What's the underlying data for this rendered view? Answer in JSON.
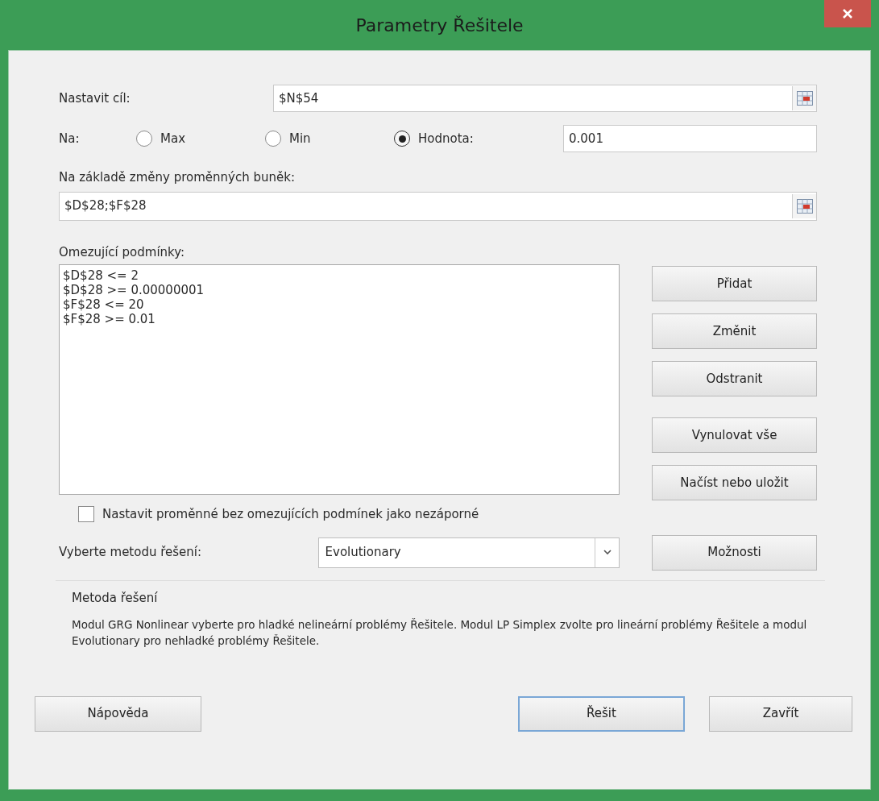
{
  "window": {
    "title": "Parametry Řešitele"
  },
  "objective": {
    "label": "Nastavit cíl:",
    "value": "$N$54"
  },
  "target": {
    "label": "Na:",
    "options": [
      {
        "label": "Max",
        "selected": false
      },
      {
        "label": "Min",
        "selected": false
      },
      {
        "label": "Hodnota:",
        "selected": true
      }
    ],
    "value": "0.001"
  },
  "variables": {
    "label": "Na základě změny proměnných buněk:",
    "value": "$D$28;$F$28"
  },
  "constraints": {
    "label": "Omezující podmínky:",
    "items": [
      "$D$28 <= 2",
      "$D$28 >= 0.00000001",
      "$F$28 <= 20",
      "$F$28 >= 0.01"
    ]
  },
  "constraint_buttons": [
    "Přidat",
    "Změnit",
    "Odstranit",
    "Vynulovat vše",
    "Načíst nebo uložit"
  ],
  "nonnegative": {
    "label": "Nastavit proměnné bez omezujících podmínek jako nezáporné",
    "checked": false
  },
  "method": {
    "label": "Vyberte metodu řešení:",
    "value": "Evolutionary",
    "options_button": "Možnosti"
  },
  "method_info": {
    "title": "Metoda řešení",
    "text": "Modul GRG Nonlinear vyberte pro hladké nelineární problémy Řešitele. Modul LP Simplex zvolte pro lineární problémy Řešitele a modul Evolutionary pro nehladké problémy Řešitele."
  },
  "footer_buttons": [
    {
      "label": "Nápověda",
      "selected": false
    },
    {
      "label": "Řešit",
      "selected": true
    },
    {
      "label": "Zavřít",
      "selected": false
    }
  ]
}
